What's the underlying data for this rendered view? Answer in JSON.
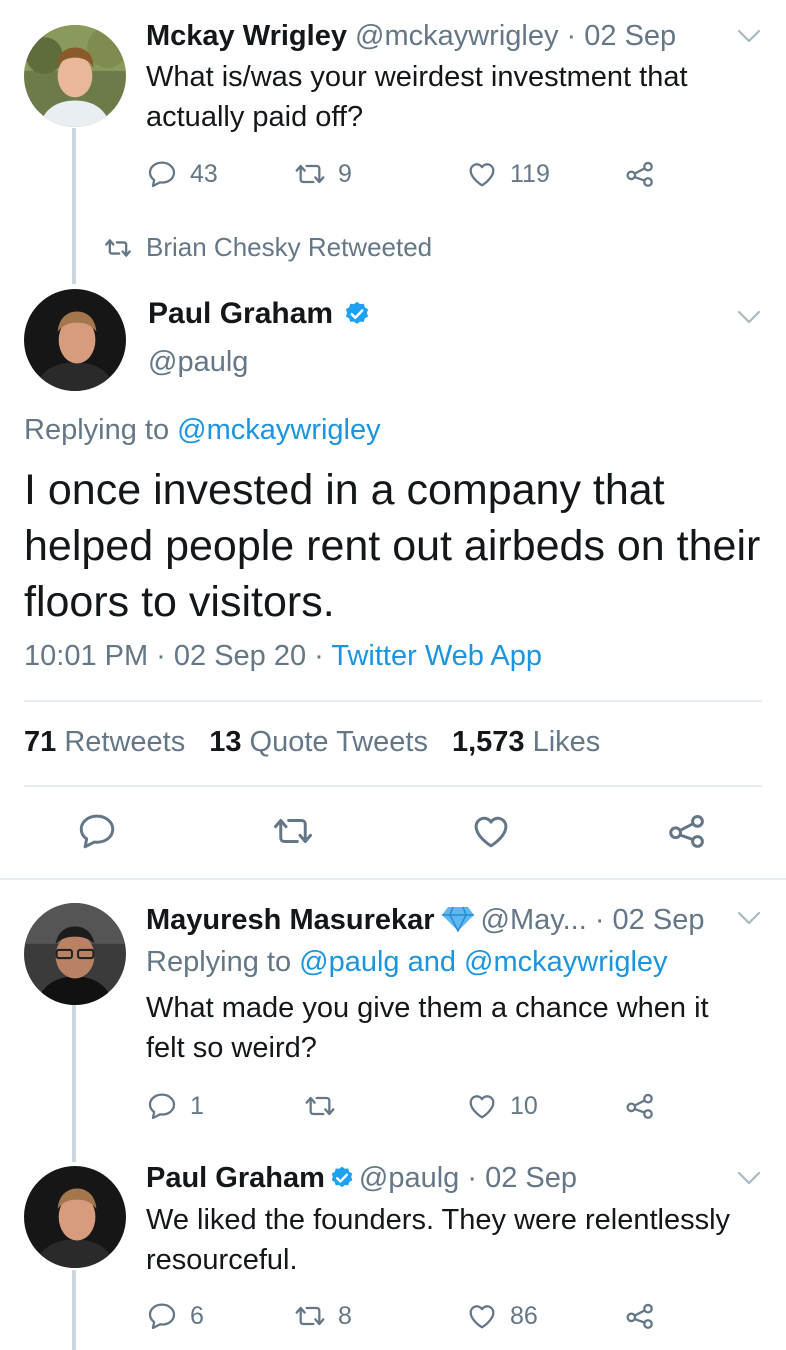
{
  "tweet1": {
    "name": "Mckay Wrigley",
    "handle": "@mckaywrigley",
    "date": "· 02 Sep",
    "text_line1": "What is/was your weirdest investment that",
    "text_line2": "actually paid off?",
    "replies": "43",
    "retweets": "9",
    "likes": "119"
  },
  "retweet_note": "Brian Chesky Retweeted",
  "main": {
    "name": "Paul Graham",
    "handle": "@paulg",
    "replying_prefix": "Replying to ",
    "replying_handle": "@mckaywrigley",
    "text": "I once invested in a company that helped people rent out airbeds on their floors to visitors.",
    "time": "10:01 PM · 02 Sep 20 · ",
    "client": "Twitter Web App",
    "retweets_count": "71",
    "retweets_label": "Retweets",
    "quotes_count": "13",
    "quotes_label": "Quote Tweets",
    "likes_count": "1,573",
    "likes_label": "Likes"
  },
  "reply1": {
    "name": "Mayuresh Masurekar",
    "handle": "@May...",
    "date": "· 02 Sep",
    "replying_prefix": "Replying to ",
    "replying_handles": "@paulg and @mckaywrigley",
    "text_line1": "What made you give them a chance when it",
    "text_line2": "felt so weird?",
    "replies": "1",
    "retweets": "",
    "likes": "10"
  },
  "reply2": {
    "name": "Paul Graham",
    "handle": "@paulg",
    "date": "· 02 Sep",
    "text_line1": "We liked the founders. They were relentlessly",
    "text_line2": "resourceful.",
    "replies": "6",
    "retweets": "8",
    "likes": "86"
  },
  "colors": {
    "link": "#1b95e0",
    "muted": "#657786",
    "text": "#14171a",
    "divider": "#e6ecf0",
    "verified": "#1da1f2"
  },
  "icons": [
    "reply-icon",
    "retweet-icon",
    "like-icon",
    "share-icon",
    "chevron-down-icon",
    "verified-badge-icon",
    "diamond-icon"
  ]
}
